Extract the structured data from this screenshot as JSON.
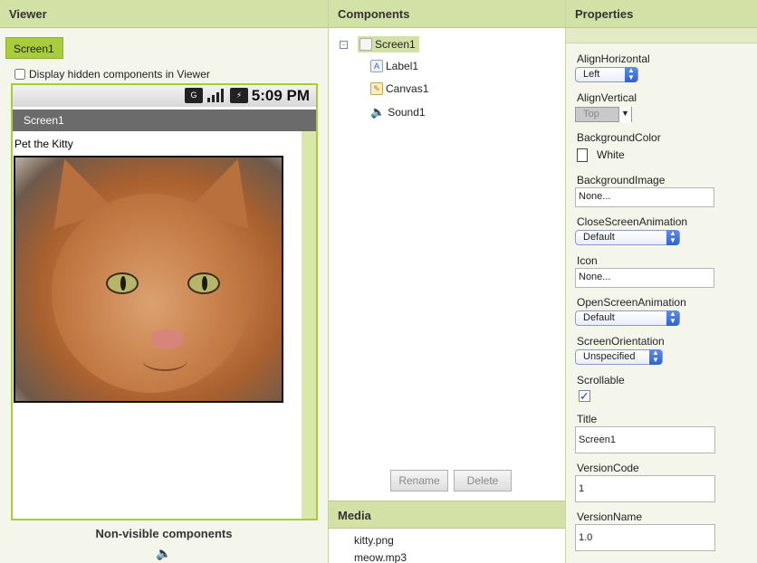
{
  "viewer": {
    "header": "Viewer",
    "screen_tab": "Screen1",
    "display_hidden_label": "Display hidden components in Viewer",
    "phone": {
      "status_time": "5:09 PM",
      "title": "Screen1",
      "label_text": "Pet the Kitty"
    },
    "nonvisible_label": "Non-visible components"
  },
  "components": {
    "header": "Components",
    "tree": {
      "root": "Screen1",
      "children": [
        "Label1",
        "Canvas1",
        "Sound1"
      ]
    },
    "rename_button": "Rename",
    "delete_button": "Delete"
  },
  "media": {
    "header": "Media",
    "files": [
      "kitty.png",
      "meow.mp3"
    ]
  },
  "properties": {
    "header": "Properties",
    "align_horizontal": {
      "label": "AlignHorizontal",
      "value": "Left"
    },
    "align_vertical": {
      "label": "AlignVertical",
      "value": "Top"
    },
    "background_color": {
      "label": "BackgroundColor",
      "value": "White"
    },
    "background_image": {
      "label": "BackgroundImage",
      "value": "None..."
    },
    "close_screen_animation": {
      "label": "CloseScreenAnimation",
      "value": "Default"
    },
    "icon": {
      "label": "Icon",
      "value": "None..."
    },
    "open_screen_animation": {
      "label": "OpenScreenAnimation",
      "value": "Default"
    },
    "screen_orientation": {
      "label": "ScreenOrientation",
      "value": "Unspecified"
    },
    "scrollable": {
      "label": "Scrollable",
      "checked": true
    },
    "title": {
      "label": "Title",
      "value": "Screen1"
    },
    "version_code": {
      "label": "VersionCode",
      "value": "1"
    },
    "version_name": {
      "label": "VersionName",
      "value": "1.0"
    }
  },
  "colors": {
    "panel_header": "#d3e0a6",
    "accent_green": "#a8cc3b",
    "phone_titlebar": "#6b6b6b",
    "select_arrow": "#2f62c9"
  }
}
